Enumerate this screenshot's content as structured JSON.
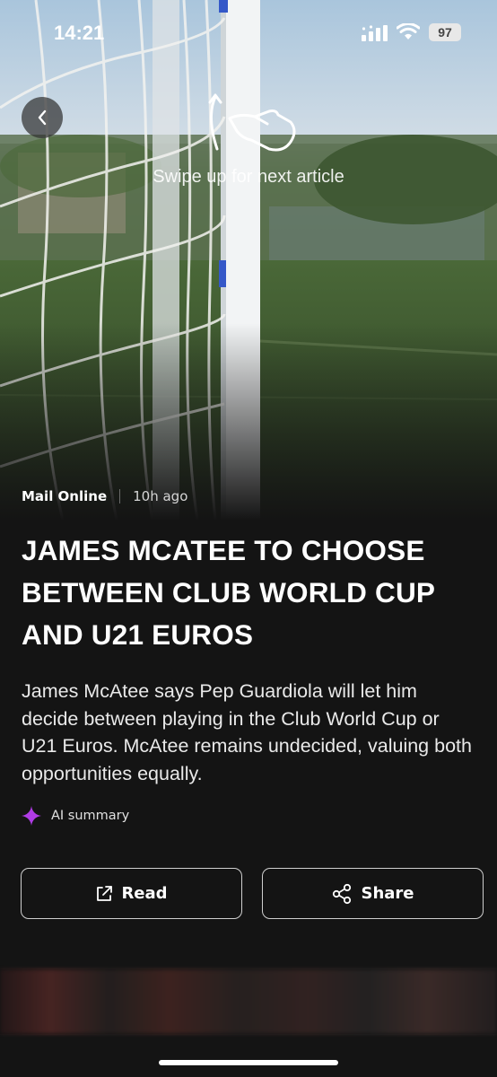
{
  "status_bar": {
    "time": "14:21",
    "battery": "97",
    "icons": [
      "signal-icon",
      "wifi-icon",
      "battery-icon"
    ]
  },
  "navigation": {
    "back_icon": "chevron-left-icon"
  },
  "swipe_hint": {
    "text": "Swipe up for next article",
    "icon": "swipe-up-hand-icon"
  },
  "article": {
    "source": "Mail Online",
    "time_ago": "10h ago",
    "headline": "JAMES MCATEE TO CHOOSE BETWEEN CLUB WORLD CUP AND U21 EUROS",
    "summary": "James McAtee says Pep Guardiola will let him decide between playing in the Club World Cup or U21 Euros. McAtee remains undecided, valuing both opportunities equally.",
    "ai_label": "AI summary",
    "ai_icon": "sparkle-icon",
    "ai_color": "#b03ce6"
  },
  "actions": {
    "read_label": "Read",
    "read_icon": "external-link-icon",
    "share_label": "Share",
    "share_icon": "share-icon"
  }
}
